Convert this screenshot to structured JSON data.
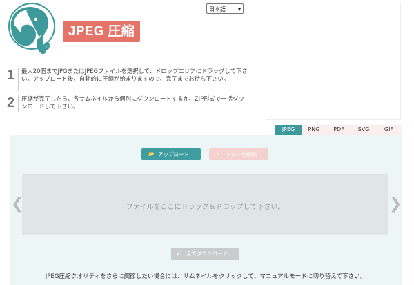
{
  "header": {
    "title": "JPEG 圧縮",
    "logo_icon": "elephant-logo-icon",
    "language_selected": "日本語"
  },
  "steps": [
    {
      "number": "1",
      "text": "最大20個までJPGまたはJPEGファイルを選択して、ドロップエリアにドラッグして下さい。アップロード後、自動的に圧縮が始まりますので、完了までお待ち下さい。"
    },
    {
      "number": "2",
      "text": "圧縮が完了したら、各サムネイルから個別にダウンロードするか、ZIP形式で一括ダウンロードして下さい。"
    }
  ],
  "tabs": [
    {
      "label": "JPEG",
      "active": true
    },
    {
      "label": "PNG",
      "active": false
    },
    {
      "label": "PDF",
      "active": false
    },
    {
      "label": "SVG",
      "active": false
    },
    {
      "label": "GIF",
      "active": false
    }
  ],
  "toolbar": {
    "upload_label": "アップロード",
    "upload_icon": "folder-open-icon",
    "clear_label": "キューを削除",
    "clear_icon": "close-icon"
  },
  "dropzone": {
    "text": "ファイルをここにドラッグ＆ドロップして下さい。",
    "prev_icon": "chevron-left-icon",
    "next_icon": "chevron-right-icon"
  },
  "download_all": {
    "label": "全てダウンロード",
    "icon": "check-icon"
  },
  "footnote": "JPEG圧縮クオリティをさらに調節したい場合には、サムネイルをクリックして、マニュアルモードに切り替えて下さい。",
  "colors": {
    "accent_teal": "#3e9a9a",
    "title_red": "#e57368",
    "panel_bg": "#ecf6f7",
    "tab_bg": "#fbeeed"
  }
}
